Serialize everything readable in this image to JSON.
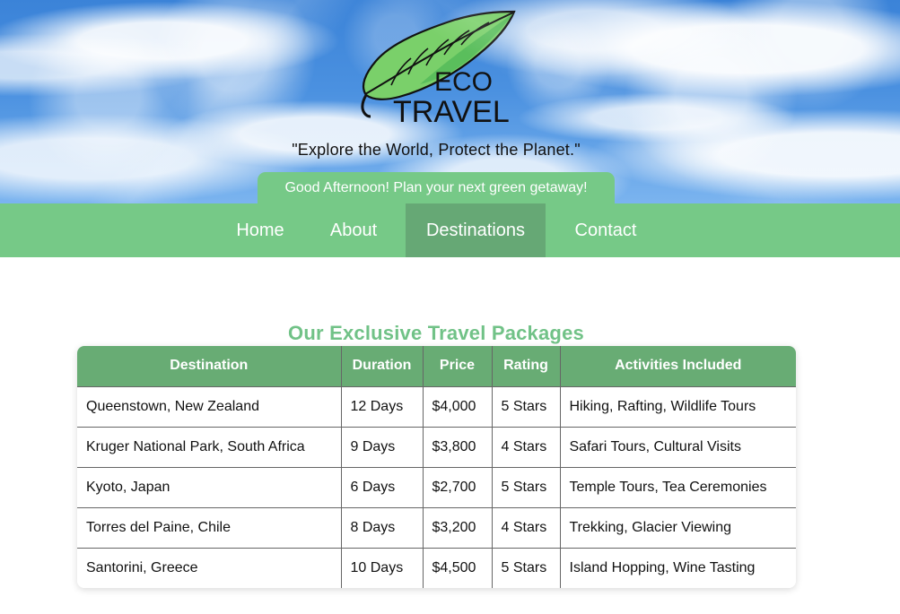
{
  "brand": {
    "logo_top": "ECO",
    "logo_bottom": "TRAVEL",
    "tagline": "\"Explore the World, Protect the Planet.\"",
    "greeting": "Good Afternoon! Plan your next green getaway!"
  },
  "nav": {
    "items": [
      {
        "label": "Home"
      },
      {
        "label": "About"
      },
      {
        "label": "Destinations"
      },
      {
        "label": "Contact"
      }
    ]
  },
  "main": {
    "title": "Our Exclusive Travel Packages",
    "table": {
      "headers": [
        "Destination",
        "Duration",
        "Price",
        "Rating",
        "Activities Included"
      ],
      "rows": [
        [
          "Queenstown, New Zealand",
          "12 Days",
          "$4,000",
          "5 Stars",
          "Hiking, Rafting, Wildlife Tours"
        ],
        [
          "Kruger National Park, South Africa",
          "9 Days",
          "$3,800",
          "4 Stars",
          "Safari Tours, Cultural Visits"
        ],
        [
          "Kyoto, Japan",
          "6 Days",
          "$2,700",
          "5 Stars",
          "Temple Tours, Tea Ceremonies"
        ],
        [
          "Torres del Paine, Chile",
          "8 Days",
          "$3,200",
          "4 Stars",
          "Trekking, Glacier Viewing"
        ],
        [
          "Santorini, Greece",
          "10 Days",
          "$4,500",
          "5 Stars",
          "Island Hopping, Wine Tasting"
        ]
      ]
    }
  },
  "icons": {
    "logo": "leaf-icon"
  },
  "colors": {
    "sky": "#4b91e0",
    "nav_green": "#76c987",
    "active_green": "#66a875",
    "title_green": "#71c287",
    "header_green": "#68ac74"
  }
}
